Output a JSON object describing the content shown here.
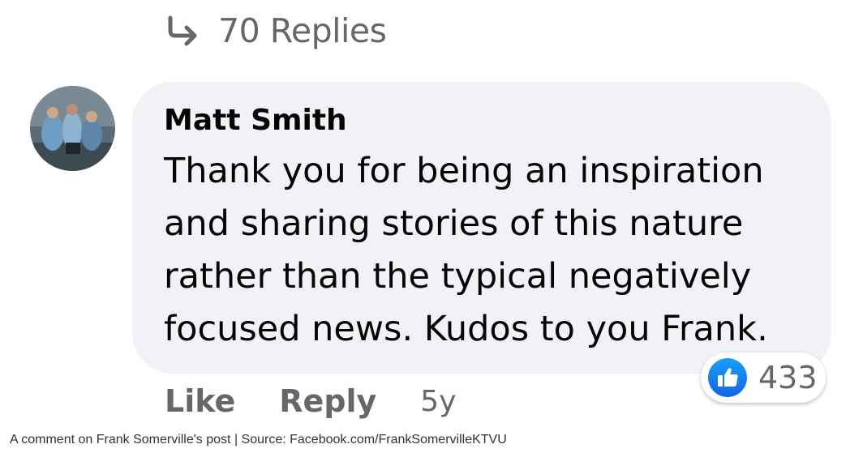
{
  "replies": {
    "label": "70 Replies",
    "icon": "reply-arrow-icon"
  },
  "comment": {
    "author": "Matt Smith",
    "avatar_icon": "user-photo-avatar",
    "lines": [
      "Thank you for being an inspiration",
      "and sharing stories of this nature",
      "rather than the typical negatively",
      "focused news. Kudos to you Frank."
    ],
    "reactions": {
      "icon": "thumbs-up-icon",
      "count": "433"
    },
    "actions": {
      "like_label": "Like",
      "reply_label": "Reply",
      "time": "5y"
    }
  },
  "caption": "A comment on Frank Somerville's post | Source: Facebook.com/FrankSomervilleKTVU",
  "colors": {
    "bubble_bg": "#f0f2f5",
    "text": "#050505",
    "secondary_text": "#65676b",
    "like_blue": "#1877f2"
  }
}
